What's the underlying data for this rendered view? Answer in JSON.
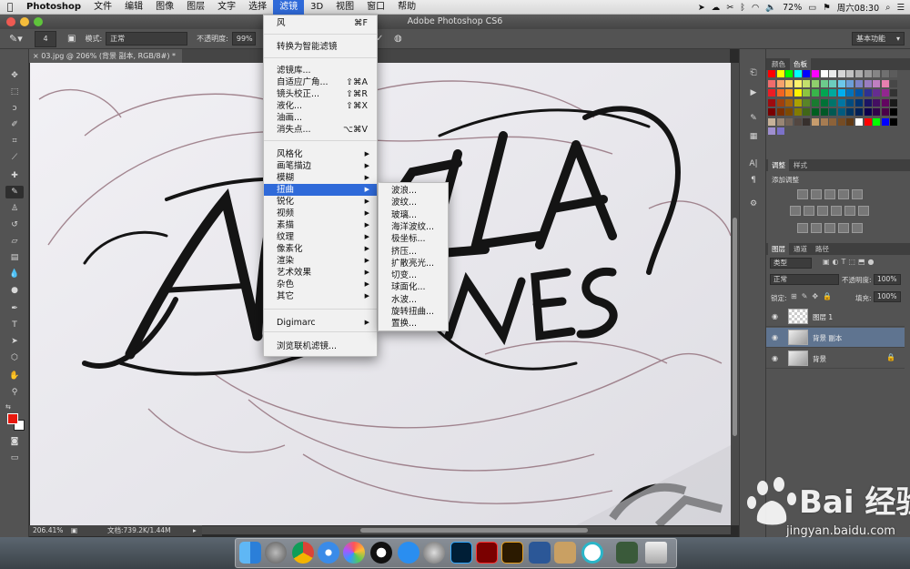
{
  "mac_menubar": {
    "app_name": "Photoshop",
    "items": [
      "文件",
      "编辑",
      "图像",
      "图层",
      "文字",
      "选择",
      "滤镜",
      "3D",
      "视图",
      "窗口",
      "帮助"
    ],
    "active_item": "滤镜",
    "status": {
      "battery": "72%",
      "clock": "周六08:30"
    }
  },
  "window": {
    "title": "Adobe Photoshop CS6"
  },
  "options_bar": {
    "brush_size": "4",
    "mode_label": "模式:",
    "mode_value": "正常",
    "opacity_label": "不透明度:",
    "opacity_value": "99%",
    "workspace": "基本功能"
  },
  "document": {
    "tab_title": "03.jpg @ 206% (背景 副本, RGB/8#) *",
    "zoom": "206.41%",
    "doc_size": "文档:739.2K/1.44M"
  },
  "filter_menu": {
    "items": [
      {
        "label": "风",
        "shortcut": "⌘F"
      },
      {
        "label": "转换为智能滤镜",
        "shortcut": ""
      },
      {
        "label": "滤镜库...",
        "shortcut": ""
      },
      {
        "label": "自适应广角...",
        "shortcut": "⇧⌘A"
      },
      {
        "label": "镜头校正...",
        "shortcut": "⇧⌘R"
      },
      {
        "label": "液化...",
        "shortcut": "⇧⌘X"
      },
      {
        "label": "油画...",
        "shortcut": ""
      },
      {
        "label": "消失点...",
        "shortcut": "⌥⌘V"
      },
      {
        "label": "风格化",
        "shortcut": ""
      },
      {
        "label": "画笔描边",
        "shortcut": ""
      },
      {
        "label": "模糊",
        "shortcut": ""
      },
      {
        "label": "扭曲",
        "shortcut": ""
      },
      {
        "label": "锐化",
        "shortcut": ""
      },
      {
        "label": "视频",
        "shortcut": ""
      },
      {
        "label": "素描",
        "shortcut": ""
      },
      {
        "label": "纹理",
        "shortcut": ""
      },
      {
        "label": "像素化",
        "shortcut": ""
      },
      {
        "label": "渲染",
        "shortcut": ""
      },
      {
        "label": "艺术效果",
        "shortcut": ""
      },
      {
        "label": "杂色",
        "shortcut": ""
      },
      {
        "label": "其它",
        "shortcut": ""
      },
      {
        "label": "Digimarc",
        "shortcut": ""
      },
      {
        "label": "浏览联机滤镜...",
        "shortcut": ""
      }
    ],
    "highlighted": "扭曲"
  },
  "distort_submenu": {
    "items": [
      "波浪...",
      "波纹...",
      "玻璃...",
      "海洋波纹...",
      "极坐标...",
      "挤压...",
      "扩散亮光...",
      "切变...",
      "球面化...",
      "水波...",
      "旋转扭曲...",
      "置换..."
    ]
  },
  "panels": {
    "color_tabs": [
      "颜色",
      "色板"
    ],
    "adjust_tabs": [
      "调整",
      "样式"
    ],
    "adjust_title": "添加调整",
    "layers_tabs": [
      "图层",
      "通道",
      "路径"
    ],
    "kind_filter": "类型",
    "blend_mode": "正常",
    "opacity_label": "不透明度:",
    "opacity_value": "100%",
    "lock_label": "锁定:",
    "fill_label": "填充:",
    "fill_value": "100%",
    "layers": [
      {
        "name": "图层 1",
        "active": false,
        "locked": false
      },
      {
        "name": "背景 副本",
        "active": true,
        "locked": false
      },
      {
        "name": "背景",
        "active": false,
        "locked": true
      }
    ]
  },
  "colors": {
    "foreground": "#e8180e",
    "background": "#ffffff",
    "highlight": "#2f6ad9"
  },
  "watermark": {
    "brand": "Bai  经验",
    "url": "jingyan.baidu.com"
  }
}
